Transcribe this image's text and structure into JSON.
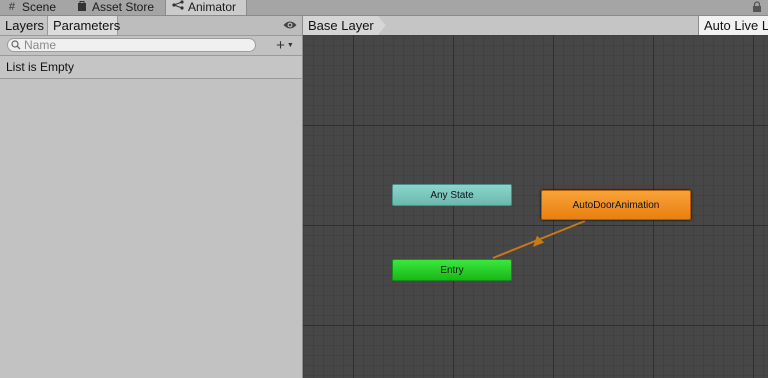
{
  "tabs": [
    {
      "label": "Scene",
      "icon": "hash-icon"
    },
    {
      "label": "Asset Store",
      "icon": "bag-icon"
    },
    {
      "label": "Animator",
      "icon": "animator-icon"
    }
  ],
  "left_panel": {
    "tabs": {
      "layers": "Layers",
      "parameters": "Parameters"
    },
    "search": {
      "placeholder": "Name",
      "value": ""
    },
    "add_button": "+",
    "empty_message": "List is Empty"
  },
  "graph": {
    "breadcrumb": "Base Layer",
    "auto_live_link": "Auto Live Lin",
    "states": {
      "any_state": "Any State",
      "entry": "Entry",
      "default_state": "AutoDoorAnimation"
    }
  },
  "colors": {
    "any_state": "#6fc3b9",
    "entry": "#2bd22b",
    "default_state": "#f29025",
    "transition": "#c9781a",
    "graph_bg": "#474747"
  }
}
